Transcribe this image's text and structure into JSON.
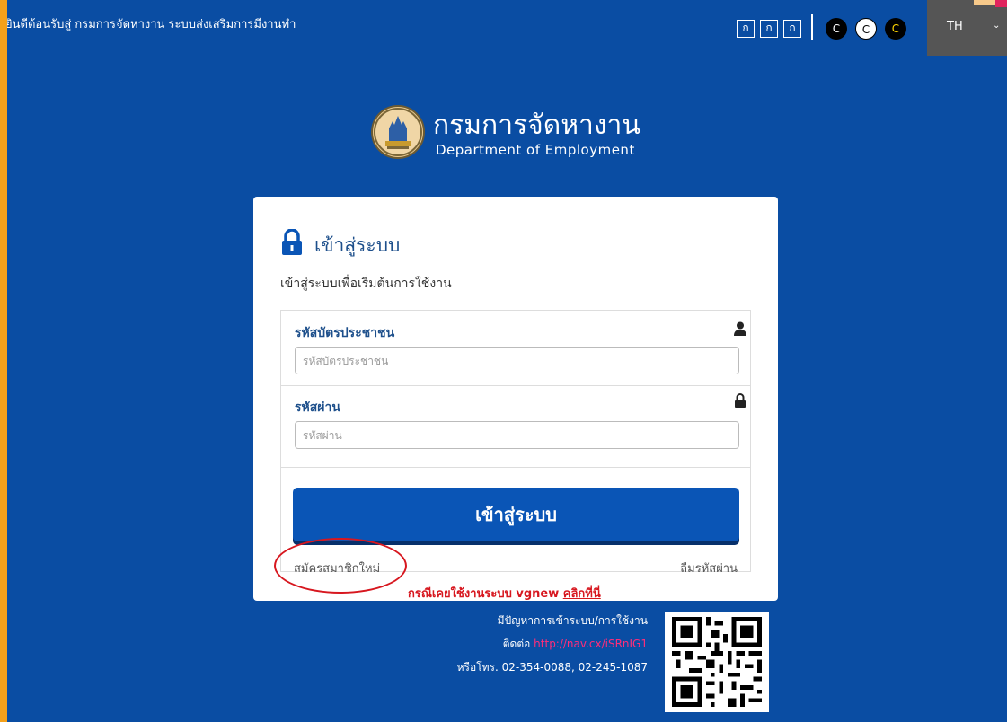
{
  "header": {
    "welcome_text": "ยินดีต้อนรับสู่ กรมการจัดหางาน ระบบส่งเสริมการมีงานทำ",
    "font_size_buttons": [
      "ก",
      "ก",
      "ก"
    ],
    "contrast_buttons": [
      "C",
      "C",
      "C"
    ],
    "language": "TH"
  },
  "brand": {
    "title": "กรมการจัดหางาน",
    "subtitle": "Department of Employment"
  },
  "login": {
    "title": "เข้าสู่ระบบ",
    "description": "เข้าสู่ระบบเพื่อเริ่มต้นการใช้งาน",
    "id_label": "รหัสบัตรประชาชน",
    "id_placeholder": "รหัสบัตรประชาชน",
    "password_label": "รหัสผ่าน",
    "password_placeholder": "รหัสผ่าน",
    "submit_label": "เข้าสู่ระบบ",
    "register_link": "สมัครสมาชิกใหม่",
    "forgot_link": "ลืมรหัสผ่าน",
    "vgnew_text": "กรณีเคยใช้งานระบบ vgnew",
    "vgnew_link": "คลิกที่นี่"
  },
  "help": {
    "line1": "มีปัญหาการเข้าระบบ/การใช้งาน",
    "contact_label": "ติดต่อ",
    "contact_url": "http://nav.cx/iSRnIG1",
    "phone": "หรือโทร. 02-354-0088, 02-245-1087"
  },
  "colors": {
    "frame": "#f5a11a",
    "background": "#0a4da3",
    "primary_button": "#0a55b6",
    "label": "#1d4f8b",
    "annotation": "#d7171f",
    "link_pink": "#ff2d7a"
  },
  "icons": [
    "lock-icon",
    "user-icon",
    "padlock-icon",
    "chevron-down-icon",
    "qr-code"
  ]
}
